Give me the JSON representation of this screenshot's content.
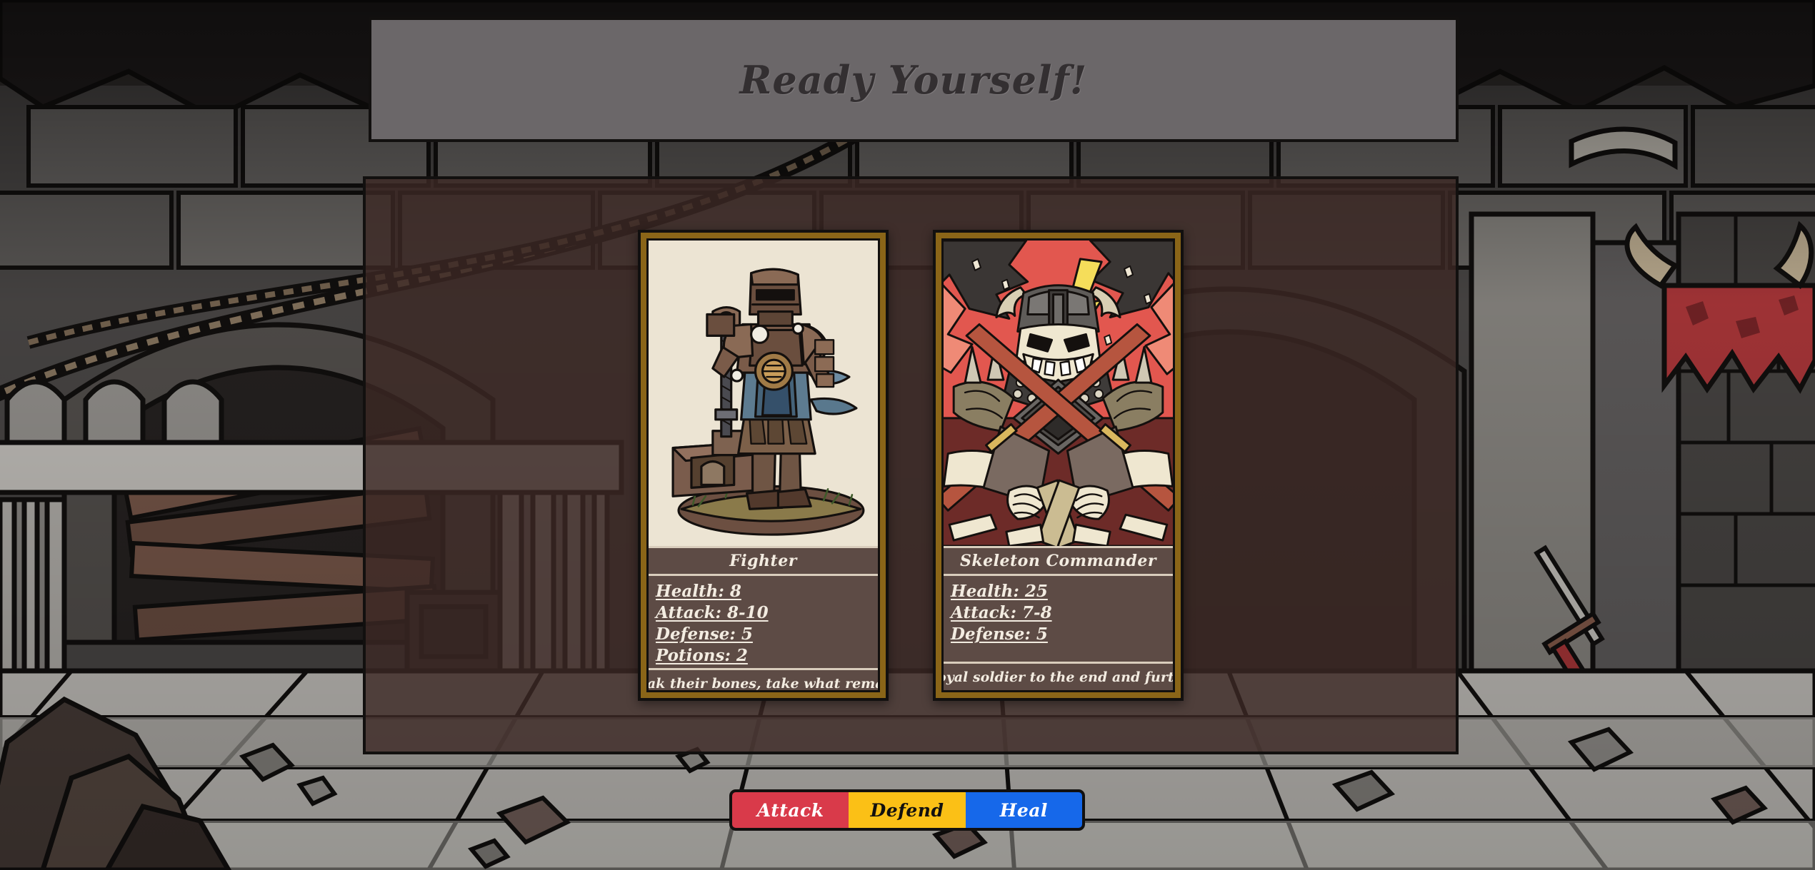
{
  "header": {
    "title": "Ready Yourself!"
  },
  "cards": [
    {
      "name": "Fighter",
      "art": "armored-knight-with-warhammer",
      "art_bg": "#ece4d3",
      "stats": [
        "Health: 8",
        "Attack: 8-10",
        "Defense: 5",
        "Potions: 2"
      ],
      "quote": "\"Break their bones, take what remains\""
    },
    {
      "name": "Skeleton Commander",
      "art": "horned-skeleton-commander-with-crossed-weapons",
      "art_bg": "#e2574f",
      "stats": [
        "Health: 25",
        "Attack: 7-8",
        "Defense: 5"
      ],
      "quote": "\"A loyal soldier to the end and further\""
    }
  ],
  "actions": [
    {
      "label": "Attack",
      "bg": "#d93a4a",
      "fg": "#ffffff"
    },
    {
      "label": "Defend",
      "bg": "#fbc016",
      "fg": "#12100f"
    },
    {
      "label": "Heal",
      "bg": "#1668ea",
      "fg": "#ffffff"
    }
  ],
  "colors": {
    "title_bar": "#6b6769",
    "panel": "#4a3633",
    "card_border_gold": "#8a6518",
    "card_body": "#5d4b45",
    "divider": "#d9cdbc",
    "text_light": "#f3ece1",
    "outline": "#12100f"
  }
}
